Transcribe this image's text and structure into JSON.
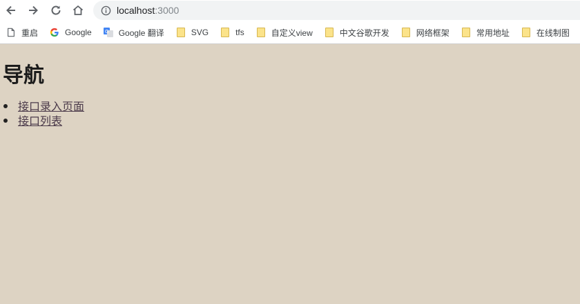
{
  "browser": {
    "url_host": "localhost",
    "url_port": ":3000"
  },
  "bookmarks": [
    {
      "label": "重启",
      "icon": "page-icon"
    },
    {
      "label": "Google",
      "icon": "google-icon"
    },
    {
      "label": "Google 翻译",
      "icon": "translate-icon"
    },
    {
      "label": "SVG",
      "icon": "folder-icon"
    },
    {
      "label": "tfs",
      "icon": "folder-icon"
    },
    {
      "label": "自定义view",
      "icon": "folder-icon"
    },
    {
      "label": "中文谷歌开发",
      "icon": "folder-icon"
    },
    {
      "label": "网络框架",
      "icon": "folder-icon"
    },
    {
      "label": "常用地址",
      "icon": "folder-icon"
    },
    {
      "label": "在线制图",
      "icon": "folder-icon"
    }
  ],
  "page": {
    "title": "导航",
    "links": [
      "接口录入页面",
      "接口列表"
    ]
  }
}
